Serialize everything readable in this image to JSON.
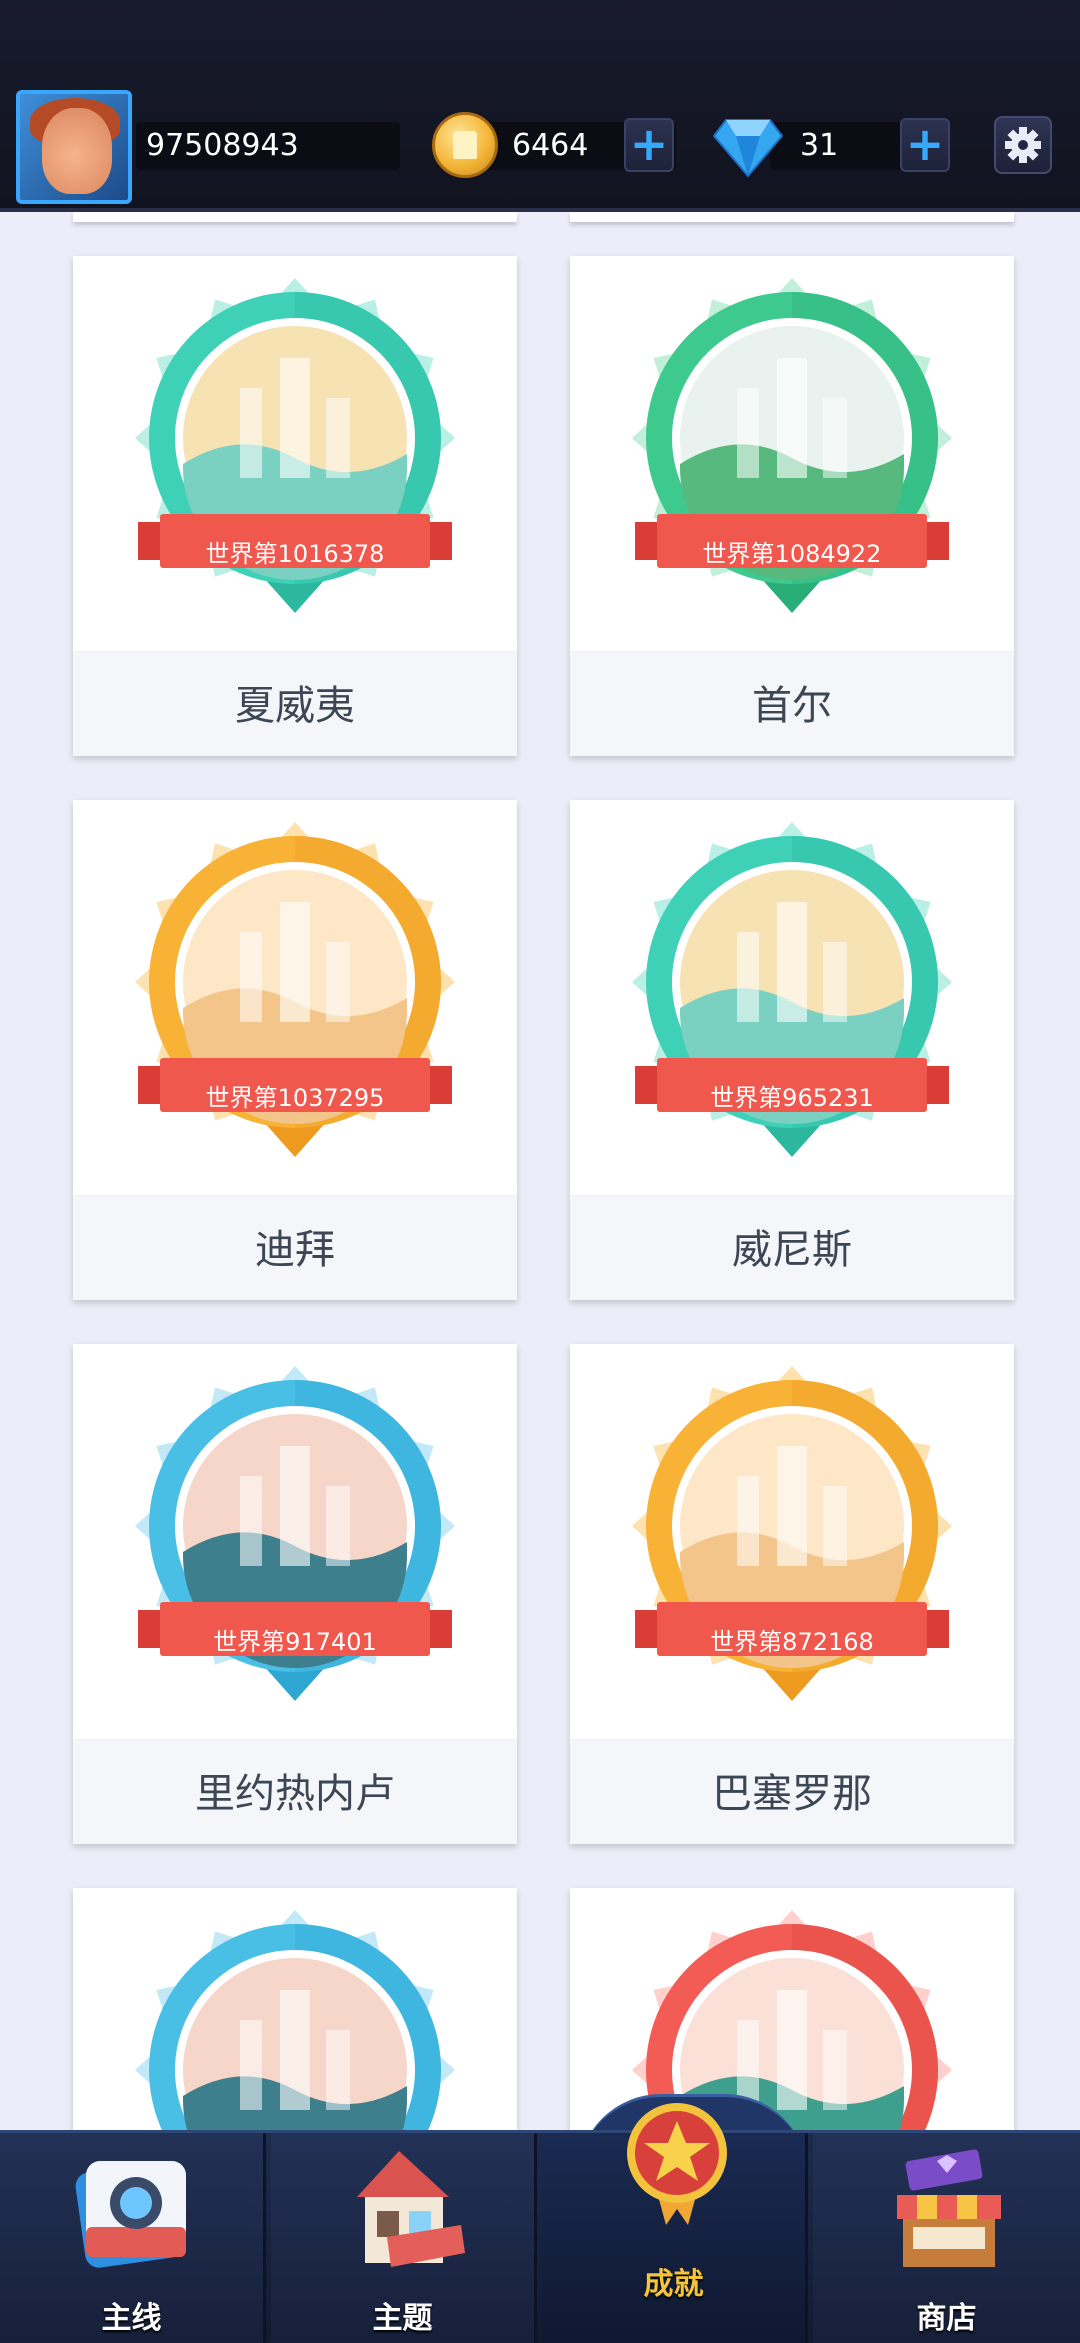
{
  "header": {
    "player_id": "97508943",
    "coins": "6464",
    "gems": "31",
    "add_coins_label": "+",
    "add_gems_label": "+",
    "settings_icon": "gear-icon"
  },
  "cards": [
    {
      "rank": "世界第1016378",
      "city": "夏威夷",
      "theme": "teal"
    },
    {
      "rank": "世界第1084922",
      "city": "首尔",
      "theme": "green"
    },
    {
      "rank": "世界第1037295",
      "city": "迪拜",
      "theme": "orange"
    },
    {
      "rank": "世界第965231",
      "city": "威尼斯",
      "theme": "teal"
    },
    {
      "rank": "世界第917401",
      "city": "里约热内卢",
      "theme": "blue"
    },
    {
      "rank": "世界第872168",
      "city": "巴塞罗那",
      "theme": "orange"
    },
    {
      "rank": "",
      "city": "",
      "theme": "blue"
    },
    {
      "rank": "",
      "city": "",
      "theme": "red"
    }
  ],
  "nav": {
    "items": [
      {
        "label": "主线",
        "icon": "camera-icon"
      },
      {
        "label": "主题",
        "icon": "house-icon"
      },
      {
        "label": "成就",
        "icon": "medal-star-icon"
      },
      {
        "label": "商店",
        "icon": "shop-icon"
      }
    ],
    "active": "成就"
  },
  "colors": {
    "teal": "#3fd1b8",
    "green": "#3ec98f",
    "orange": "#f8b236",
    "blue": "#49bfe6",
    "red": "#f35b55",
    "ribbon": "#f0574d",
    "nav_active_label": "#f5c43a"
  }
}
